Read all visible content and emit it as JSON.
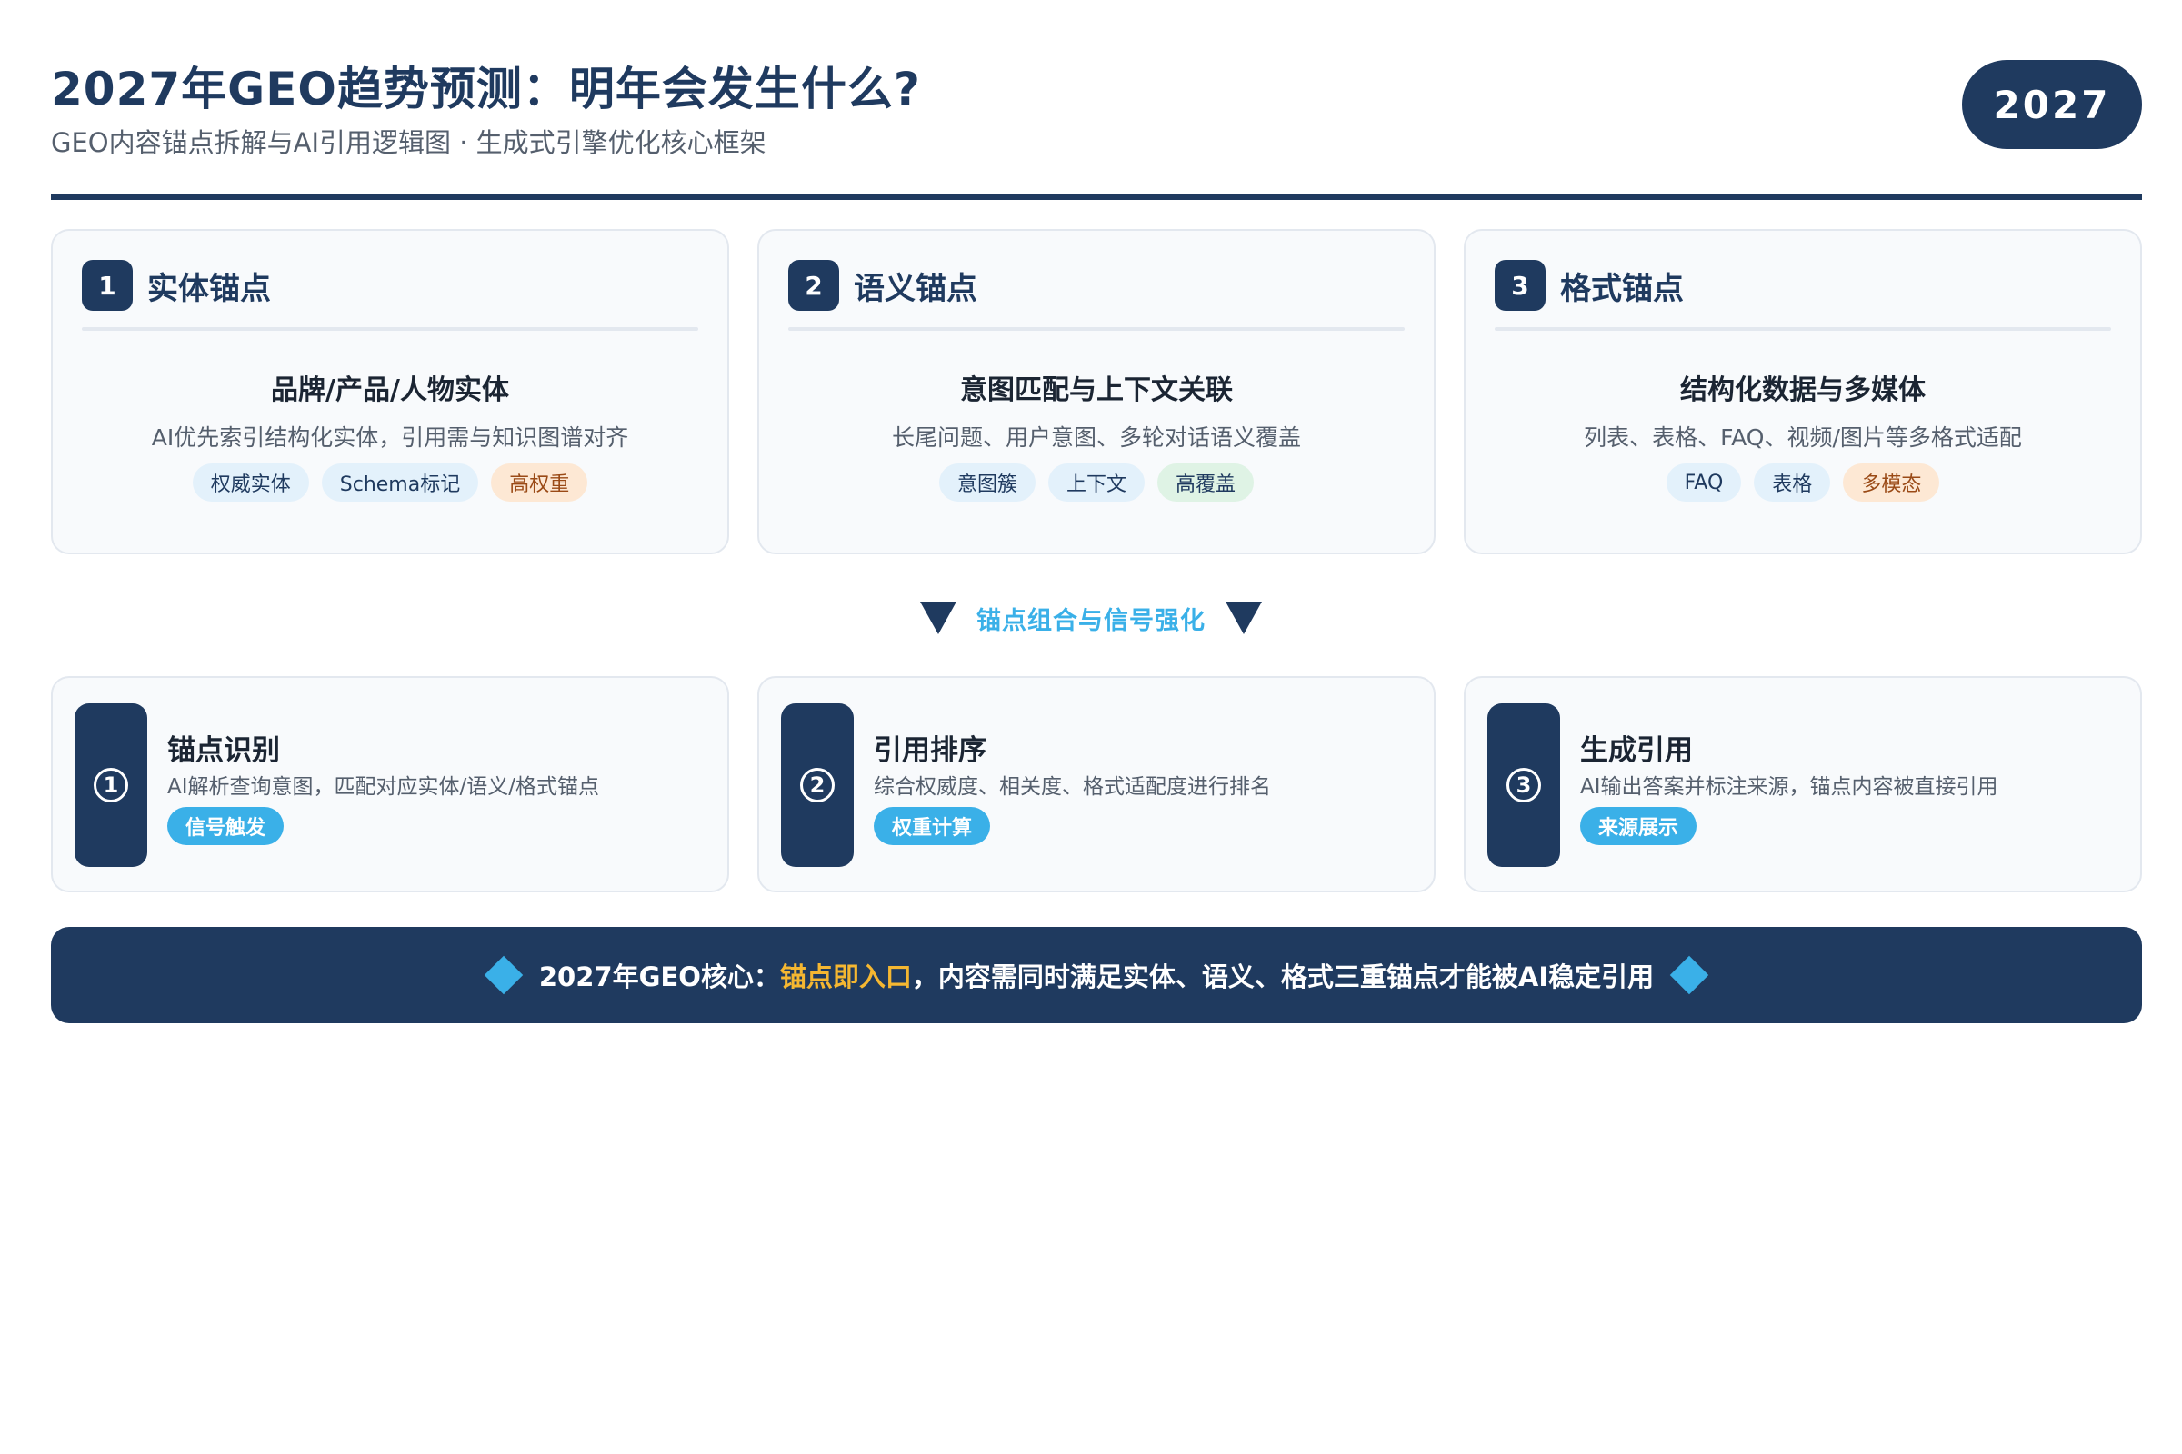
{
  "header": {
    "title": "2027年GEO趋势预测：明年会发生什么?",
    "subtitle": "GEO内容锚点拆解与AI引用逻辑图 · 生成式引擎优化核心框架",
    "year_badge": "2027"
  },
  "anchors": [
    {
      "number": "1",
      "title": "实体锚点",
      "heading": "品牌/产品/人物实体",
      "desc": "AI优先索引结构化实体，引用需与知识图谱对齐",
      "tags": [
        {
          "label": "权威实体",
          "color": "blue"
        },
        {
          "label": "Schema标记",
          "color": "blue"
        },
        {
          "label": "高权重",
          "color": "orange"
        }
      ]
    },
    {
      "number": "2",
      "title": "语义锚点",
      "heading": "意图匹配与上下文关联",
      "desc": "长尾问题、用户意图、多轮对话语义覆盖",
      "tags": [
        {
          "label": "意图簇",
          "color": "blue"
        },
        {
          "label": "上下文",
          "color": "blue"
        },
        {
          "label": "高覆盖",
          "color": "green"
        }
      ]
    },
    {
      "number": "3",
      "title": "格式锚点",
      "heading": "结构化数据与多媒体",
      "desc": "列表、表格、FAQ、视频/图片等多格式适配",
      "tags": [
        {
          "label": "FAQ",
          "color": "blue"
        },
        {
          "label": "表格",
          "color": "blue"
        },
        {
          "label": "多模态",
          "color": "orange"
        }
      ]
    }
  ],
  "connector": {
    "label": "锚点组合与信号强化"
  },
  "steps": [
    {
      "number": "1",
      "title": "锚点识别",
      "desc": "AI解析查询意图，匹配对应实体/语义/格式锚点",
      "pill": "信号触发"
    },
    {
      "number": "2",
      "title": "引用排序",
      "desc": "综合权威度、相关度、格式适配度进行排名",
      "pill": "权重计算"
    },
    {
      "number": "3",
      "title": "生成引用",
      "desc": "AI输出答案并标注来源，锚点内容被直接引用",
      "pill": "来源展示"
    }
  ],
  "footer": {
    "prefix": "2027年GEO核心：",
    "highlight": "锚点即入口",
    "suffix": "，内容需同时满足实体、语义、格式三重锚点才能被AI稳定引用"
  },
  "colors": {
    "primary": "#1f3a5f",
    "accent": "#3ab0e8",
    "highlight": "#f5b731"
  }
}
